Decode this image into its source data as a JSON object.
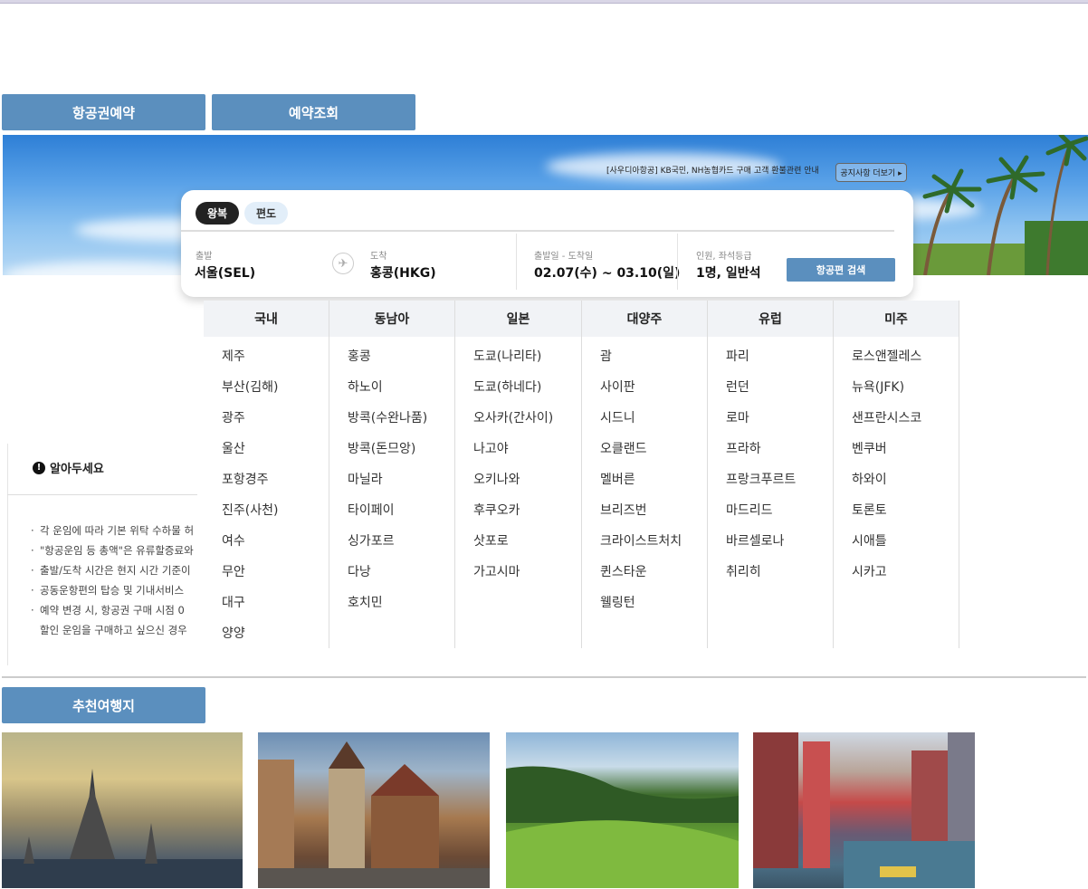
{
  "tabs": {
    "reserve": "항공권예약",
    "lookup": "예약조회",
    "recommend": "추천여행지"
  },
  "banner": {
    "notice": "[사우디아항공] KB국민, NH농협카드 구매 고객 환불관련 안내",
    "more": "공지사항 더보기 ▸"
  },
  "search": {
    "roundtrip": "왕복",
    "oneway": "편도",
    "from_label": "출발",
    "from_value": "서울(SEL)",
    "to_label": "도착",
    "to_value": "홍콩(HKG)",
    "date_label": "출발일 - 도착일",
    "date_value": "02.07(수) ~ 03.10(일)",
    "pax_label": "인원, 좌석등급",
    "pax_value": "1명, 일반석",
    "search_button": "항공편 검색"
  },
  "notice": {
    "title": "알아두세요",
    "items": [
      "각 운임에 따라 기본 위탁 수하물 허",
      "\"항공운임 등 총액\"은 유류할증료와",
      "출발/도착 시간은 현지 시간 기준이",
      "공동운항편의 탑승 및 기내서비스",
      "예약 변경 시, 항공권 구매 시점 0",
      "할인 운임을 구매하고 싶으신 경우"
    ]
  },
  "destinations": [
    {
      "region": "국내",
      "cities": [
        "제주",
        "부산(김해)",
        "광주",
        "울산",
        "포항경주",
        "진주(사천)",
        "여수",
        "무안",
        "대구",
        "양양"
      ]
    },
    {
      "region": "동남아",
      "cities": [
        "홍콩",
        "하노이",
        "방콕(수완나품)",
        "방콕(돈므앙)",
        "마닐라",
        "타이페이",
        "싱가포르",
        "다낭",
        "호치민"
      ]
    },
    {
      "region": "일본",
      "cities": [
        "도쿄(나리타)",
        "도쿄(하네다)",
        "오사카(간사이)",
        "나고야",
        "오키나와",
        "후쿠오카",
        "삿포로",
        "가고시마"
      ]
    },
    {
      "region": "대양주",
      "cities": [
        "괌",
        "사이판",
        "시드니",
        "오클랜드",
        "멜버른",
        "브리즈번",
        "크라이스트처치",
        "퀸스타운",
        "웰링턴"
      ]
    },
    {
      "region": "유럽",
      "cities": [
        "파리",
        "런던",
        "로마",
        "프라하",
        "프랑크푸르트",
        "마드리드",
        "바르셀로나",
        "취리히"
      ]
    },
    {
      "region": "미주",
      "cities": [
        "로스앤젤레스",
        "뉴욕(JFK)",
        "샌프란시스코",
        "벤쿠버",
        "하와이",
        "토론토",
        "시애틀",
        "시카고"
      ]
    }
  ]
}
